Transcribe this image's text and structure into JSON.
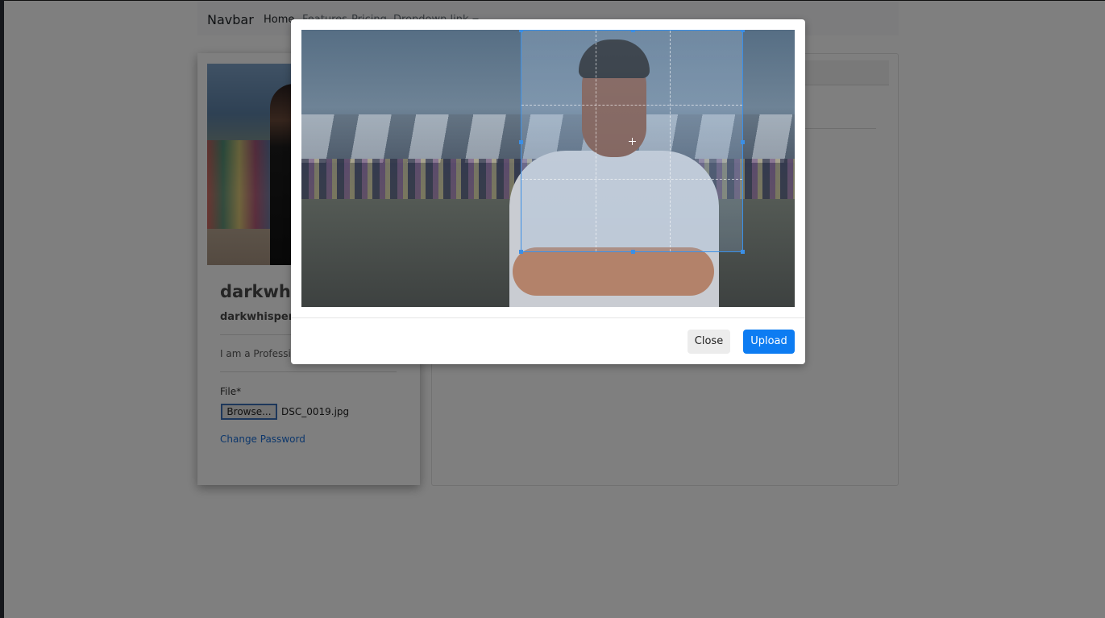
{
  "navbar": {
    "brand": "Navbar",
    "links": [
      "Home",
      "Features",
      "Pricing",
      "Dropdown link"
    ]
  },
  "profile": {
    "name": "darkwhis",
    "email": "darkwhisper@",
    "bio": "I am a Professi",
    "file_label": "File*",
    "browse_label": "Browse...",
    "file_name": "DSC_0019.jpg",
    "change_password": "Change Password"
  },
  "modal": {
    "close_label": "Close",
    "upload_label": "Upload"
  },
  "colors": {
    "primary": "#0d7cf2",
    "link": "#1a6fd9",
    "crop_border": "#3b8fe6"
  }
}
